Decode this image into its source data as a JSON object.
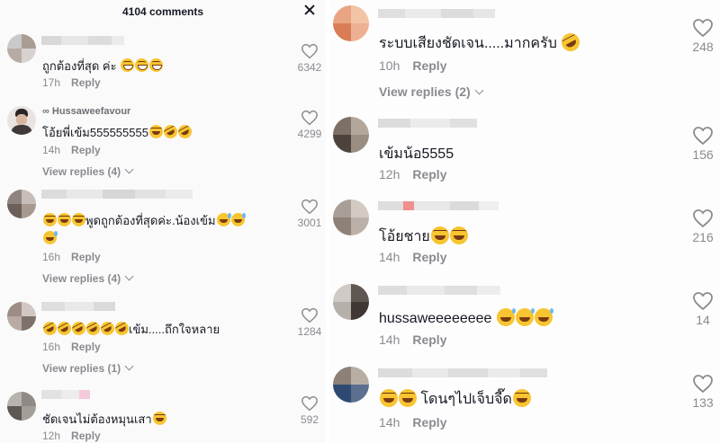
{
  "header": {
    "title": "4104 comments"
  },
  "left_comments": [
    {
      "text": "ถูกต้องที่สุด ค่ะ",
      "emojis": [
        "grin",
        "grin",
        "grin"
      ],
      "time": "17h",
      "reply": "Reply",
      "likes": "6342"
    },
    {
      "username": "∞ Hussaweefavour",
      "text": "โอ้ยพี่เข้ม555555555",
      "emojis": [
        "laugh",
        "rofl",
        "rofl"
      ],
      "time": "14h",
      "reply": "Reply",
      "likes": "4299",
      "view_replies": "View replies (4)"
    },
    {
      "text": "พูดถูกต้องที่สุดค่ะ.น้องเข้ม",
      "emojis_before": [
        "laugh",
        "laugh",
        "laugh"
      ],
      "emojis": [
        "sweat",
        "sweat"
      ],
      "emojis_line2": [
        "sweat"
      ],
      "time": "16h",
      "reply": "Reply",
      "likes": "3001",
      "view_replies": "View replies (4)"
    },
    {
      "text": "เข้ม.....ถึกใจหลาย",
      "emojis_before": [
        "rofl",
        "rofl",
        "rofl",
        "rofl",
        "rofl",
        "rofl"
      ],
      "time": "16h",
      "reply": "Reply",
      "likes": "1284",
      "view_replies": "View replies (1)"
    },
    {
      "text": "ชัดเจนไม่ต้องหมุนเสา",
      "emojis": [
        "laugh"
      ],
      "time": "12h",
      "reply": "Reply",
      "likes": "592"
    }
  ],
  "right_comments": [
    {
      "text": "ระบบเสียงชัดเจน.....มากครับ",
      "emojis": [
        "rofl"
      ],
      "time": "10h",
      "reply": "Reply",
      "likes": "248",
      "view_replies": "View replies (2)"
    },
    {
      "text": "เข้มน้อ5555",
      "time": "12h",
      "reply": "Reply",
      "likes": "156"
    },
    {
      "text": "โอ้ยชาย",
      "emojis": [
        "laugh",
        "laugh"
      ],
      "time": "14h",
      "reply": "Reply",
      "likes": "216"
    },
    {
      "text": "hussaweeeeeeee",
      "emojis": [
        "sweat",
        "sweat",
        "sweat"
      ],
      "time": "14h",
      "reply": "Reply",
      "likes": "14"
    },
    {
      "text": "โดนๆไปเจ็บจี๊ด",
      "emojis_before": [
        "laugh",
        "laugh"
      ],
      "emojis": [
        "laugh"
      ],
      "time": "14h",
      "reply": "Reply",
      "likes": "133"
    }
  ],
  "colors": {
    "text": "#161823",
    "meta": "#8a8b91",
    "emoji": "#f7c531"
  }
}
